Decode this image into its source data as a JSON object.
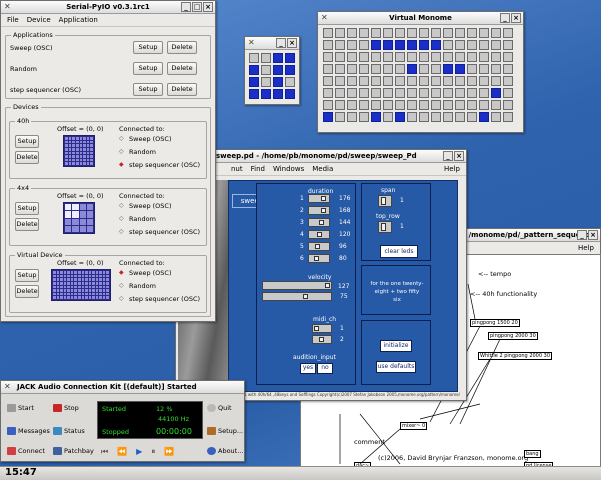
{
  "serialpyio": {
    "title": "Serial-PyIO v0.3.1rc1",
    "menu": [
      "File",
      "Device",
      "Application"
    ],
    "applications_label": "Applications",
    "apps": [
      {
        "name": "Sweep (OSC)",
        "setup": "Setup",
        "delete": "Delete"
      },
      {
        "name": "Random",
        "setup": "Setup",
        "delete": "Delete"
      },
      {
        "name": "step sequencer (OSC)",
        "setup": "Setup",
        "delete": "Delete"
      }
    ],
    "devices_label": "Devices",
    "devices": [
      {
        "name": "40h",
        "offset": "Offset = (0, 0)",
        "connected": "Connected to:",
        "setup": "Setup",
        "delete": "Delete",
        "options": [
          "Sweep (OSC)",
          "Random",
          "step sequencer (OSC)"
        ],
        "selected": 2
      },
      {
        "name": "4x4",
        "offset": "Offset = (0, 0)",
        "connected": "Connected to:",
        "setup": "Setup",
        "delete": "Delete",
        "options": [
          "Sweep (OSC)",
          "Random",
          "step sequencer (OSC)"
        ],
        "selected": -1
      },
      {
        "name": "Virtual Device",
        "offset": "Offset = (0, 0)",
        "connected": "Connected to:",
        "setup": "Setup",
        "delete": "Delete",
        "options": [
          "Sweep (OSC)",
          "Random",
          "step sequencer (OSC)"
        ],
        "selected": 0
      }
    ]
  },
  "small_monome": {
    "title": "",
    "grid": [
      [
        0,
        0,
        1,
        1
      ],
      [
        1,
        0,
        1,
        1
      ],
      [
        1,
        0,
        1,
        0
      ],
      [
        1,
        1,
        1,
        1
      ]
    ]
  },
  "virtual_monome": {
    "title": "Virtual Monome",
    "grid": [
      [
        0,
        0,
        0,
        0,
        0,
        0,
        0,
        0,
        0,
        0,
        0,
        0,
        0,
        0,
        0,
        0
      ],
      [
        0,
        0,
        0,
        0,
        1,
        1,
        1,
        1,
        1,
        1,
        0,
        0,
        0,
        0,
        0,
        0
      ],
      [
        0,
        0,
        0,
        0,
        0,
        0,
        0,
        0,
        0,
        0,
        0,
        0,
        0,
        0,
        0,
        0
      ],
      [
        0,
        0,
        0,
        0,
        0,
        0,
        0,
        1,
        0,
        0,
        1,
        1,
        0,
        0,
        0,
        0
      ],
      [
        0,
        0,
        0,
        0,
        0,
        0,
        0,
        0,
        0,
        0,
        0,
        0,
        0,
        0,
        0,
        0
      ],
      [
        0,
        0,
        0,
        0,
        0,
        0,
        0,
        0,
        0,
        0,
        0,
        0,
        0,
        0,
        1,
        0
      ],
      [
        0,
        0,
        0,
        0,
        0,
        0,
        0,
        0,
        0,
        0,
        0,
        0,
        0,
        0,
        0,
        0
      ],
      [
        1,
        0,
        0,
        0,
        1,
        0,
        1,
        0,
        0,
        0,
        0,
        0,
        0,
        1,
        0,
        0
      ]
    ]
  },
  "sweep_pd": {
    "title": "sweep.pd - /home/pb/monome/pd/sweep/sweep_Pd",
    "menu": [
      "nut",
      "Find",
      "Windows",
      "Media"
    ],
    "help": "Help",
    "sweep_label": "sweep",
    "duration_label": "duration",
    "durations": [
      {
        "n": "1",
        "v": "176"
      },
      {
        "n": "2",
        "v": "168"
      },
      {
        "n": "3",
        "v": "144"
      },
      {
        "n": "4",
        "v": "120"
      },
      {
        "n": "5",
        "v": "96"
      },
      {
        "n": "6",
        "v": "80"
      }
    ],
    "velocity_label": "velocity",
    "velocity_vals": [
      "127",
      "75"
    ],
    "midi_label": "midi_ch",
    "midi_vals": [
      "1",
      "2"
    ],
    "audition_label": "audition_input",
    "yes": "yes",
    "no": "no",
    "span_label": "span",
    "span_val": "1",
    "toprow_label": "top_row",
    "toprow_val": "1",
    "clear": "clear leds",
    "note": "for the one twenty-eight + two fifty six",
    "initialize": "initialize",
    "defaults": "use defaults",
    "footer": "sweep 1 with 40h/64 ,48keys and Sofflings Copyright(c)2007 Stefan Jakobson 2005,monome.org/pattern/monome/..."
  },
  "pattern": {
    "title": "/monome/pd/_pattern_sequence",
    "help": "Help",
    "texts": [
      "<-- tempo",
      "<-- 40h functionality",
      "pingpong 1500 20",
      "pingpong 2000 30",
      "Whittle 2  pingpong 2000 30",
      "mixer~ 0",
      "comment",
      "(c)2006, David Brynjar Franzson, monome.org",
      "bang",
      "pd license",
      "dac~"
    ]
  },
  "jack": {
    "title": "JACK Audio Connection Kit [(default)] Started",
    "buttons": [
      "Start",
      "Stop",
      "Messages",
      "Status",
      "Connect",
      "Patchbay",
      "Quit",
      "Setup...",
      "About..."
    ],
    "started": "Started",
    "pct": "12 %",
    "rate": "44100 Hz",
    "time": "00:00:00",
    "stopped": "Stopped"
  },
  "clock": "15:47",
  "colors": {
    "desktop": "#3a6bb0",
    "pd_blue": "#2659a6",
    "monome_on": "#1a2ec8"
  }
}
